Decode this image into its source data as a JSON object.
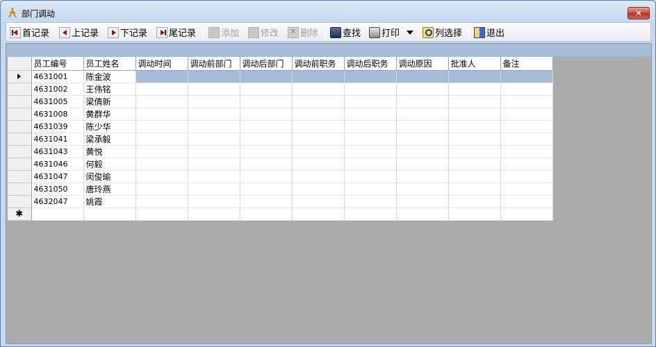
{
  "window": {
    "title": "部门调动",
    "close_label": "✕"
  },
  "toolbar": {
    "first": "首记录",
    "prev": "上记录",
    "next": "下记录",
    "last": "尾记录",
    "add": "添加",
    "edit": "修改",
    "delete": "删除",
    "find": "查找",
    "print": "打印",
    "columns": "列选择",
    "exit": "退出"
  },
  "grid": {
    "columns": [
      "员工编号",
      "员工姓名",
      "调动时间",
      "调动前部门",
      "调动后部门",
      "调动前职务",
      "调动后职务",
      "调动原因",
      "批准人",
      "备注"
    ],
    "rows": [
      [
        "4631001",
        "陈金波"
      ],
      [
        "4631002",
        "王伟铭"
      ],
      [
        "4631005",
        "梁倩新"
      ],
      [
        "4631008",
        "黄群华"
      ],
      [
        "4631039",
        "陈少华"
      ],
      [
        "4631041",
        "梁承毅"
      ],
      [
        "4631043",
        "黄悦"
      ],
      [
        "4631046",
        "何毅"
      ],
      [
        "4631047",
        "闵俊瑜"
      ],
      [
        "4631050",
        "唐玲燕"
      ],
      [
        "4632047",
        "姚霞"
      ]
    ],
    "new_row_marker": "✱"
  },
  "colors": {
    "selection": "#a6bcd6",
    "background": "#ababab",
    "close_button": "#c8483a"
  }
}
